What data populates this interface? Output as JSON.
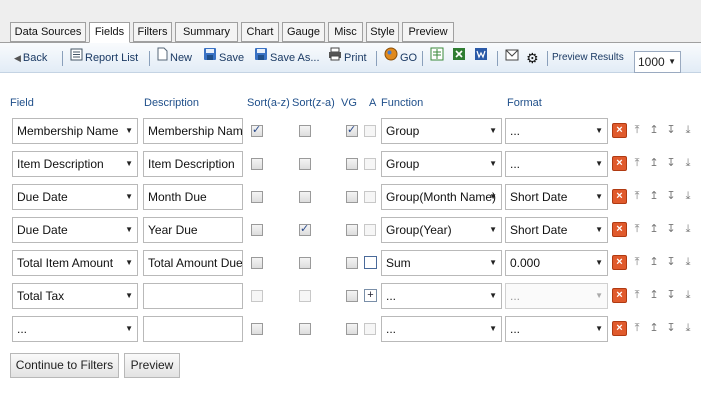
{
  "tabs": [
    "Data Sources",
    "Fields",
    "Filters",
    "Summary",
    "Chart",
    "Gauge",
    "Misc",
    "Style",
    "Preview"
  ],
  "active_tab": "Fields",
  "toolbar": {
    "back": "Back",
    "report_list": "Report List",
    "new": "New",
    "save": "Save",
    "save_as": "Save As...",
    "print": "Print",
    "go": "GO",
    "preview_results_label": "Preview Results",
    "preview_results_value": "1000"
  },
  "columns": {
    "field": "Field",
    "description": "Description",
    "sort_az": "Sort(a-z)",
    "sort_za": "Sort(z-a)",
    "vg": "VG",
    "a": "A",
    "function": "Function",
    "format": "Format"
  },
  "rows": [
    {
      "field": "Membership Name",
      "description": "Membership Name",
      "sort_az": true,
      "sort_za": false,
      "vg": true,
      "function": "Group",
      "format": "..."
    },
    {
      "field": "Item Description",
      "description": "Item Description",
      "sort_az": false,
      "sort_za": false,
      "vg": false,
      "function": "Group",
      "format": "..."
    },
    {
      "field": "Due Date",
      "description": "Month Due",
      "sort_az": false,
      "sort_za": false,
      "vg": false,
      "function": "Group(Month Name)",
      "format": "Short Date"
    },
    {
      "field": "Due Date",
      "description": "Year Due",
      "sort_az": false,
      "sort_za": true,
      "vg": false,
      "function": "Group(Year)",
      "format": "Short Date"
    },
    {
      "field": "Total Item Amount",
      "description": "Total Amount Due",
      "sort_az": false,
      "sort_za": false,
      "vg": false,
      "function": "Sum",
      "format": "0.000"
    },
    {
      "field": "Total Tax",
      "description": "",
      "sort_az": false,
      "sort_za": false,
      "vg": false,
      "function": "...",
      "format": "..."
    },
    {
      "field": "...",
      "description": "",
      "sort_az": false,
      "sort_za": false,
      "vg": false,
      "function": "...",
      "format": "..."
    }
  ],
  "buttons": {
    "continue": "Continue to Filters",
    "preview": "Preview"
  },
  "colors": {
    "toolbar_text": "#1b3a64",
    "header_text": "#1f4f8a",
    "delete": "#e05a2c"
  }
}
